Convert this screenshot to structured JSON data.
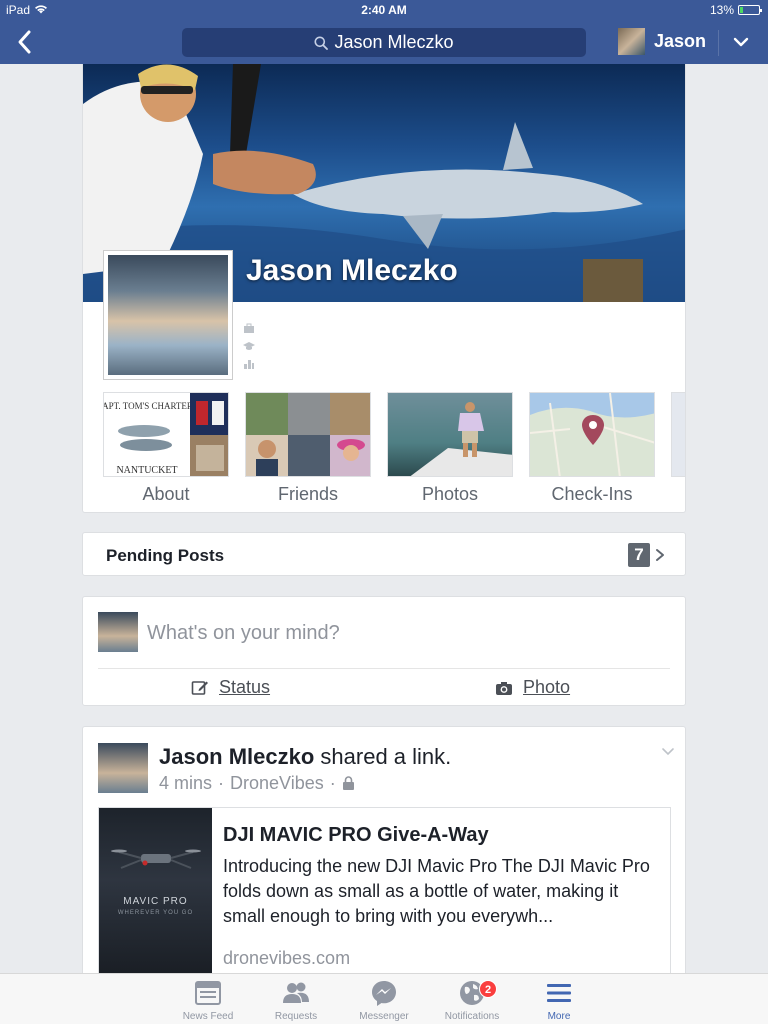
{
  "status_bar": {
    "device": "iPad",
    "time": "2:40 AM",
    "battery": "13%"
  },
  "nav": {
    "search_text": "Jason Mleczko",
    "user_name": "Jason"
  },
  "profile": {
    "name": "Jason Mleczko",
    "tiles": [
      {
        "label": "About",
        "thumb_text_top": "CAPT. TOM'S CHARTERS",
        "thumb_text_bottom": "NANTUCKET"
      },
      {
        "label": "Friends"
      },
      {
        "label": "Photos"
      },
      {
        "label": "Check-Ins"
      }
    ]
  },
  "pending": {
    "label": "Pending Posts",
    "count": "7"
  },
  "composer": {
    "prompt": "What's on your mind?",
    "status_label": "Status",
    "photo_label": "Photo"
  },
  "story": {
    "author": "Jason Mleczko",
    "action": "shared a link.",
    "time": "4 mins",
    "via": "DroneVibes",
    "link": {
      "image_brand": "MAVIC PRO",
      "image_tagline": "WHEREVER YOU GO",
      "title": "DJI MAVIC PRO Give-A-Way",
      "description": "Introducing the new DJI Mavic Pro The DJI Mavic Pro folds down as small as a bottle of water, making it small enough to bring with you everywh...",
      "domain": "dronevibes.com"
    }
  },
  "tabbar": {
    "items": [
      {
        "label": "News Feed",
        "icon": "news-feed-icon"
      },
      {
        "label": "Requests",
        "icon": "friend-requests-icon"
      },
      {
        "label": "Messenger",
        "icon": "messenger-icon"
      },
      {
        "label": "Notifications",
        "icon": "globe-icon",
        "badge": "2"
      },
      {
        "label": "More",
        "icon": "menu-icon",
        "active": true
      }
    ]
  },
  "colors": {
    "brand": "#3b5998",
    "active_tab": "#4267b2",
    "badge": "#fa3e3e",
    "background": "#e9ebee"
  }
}
